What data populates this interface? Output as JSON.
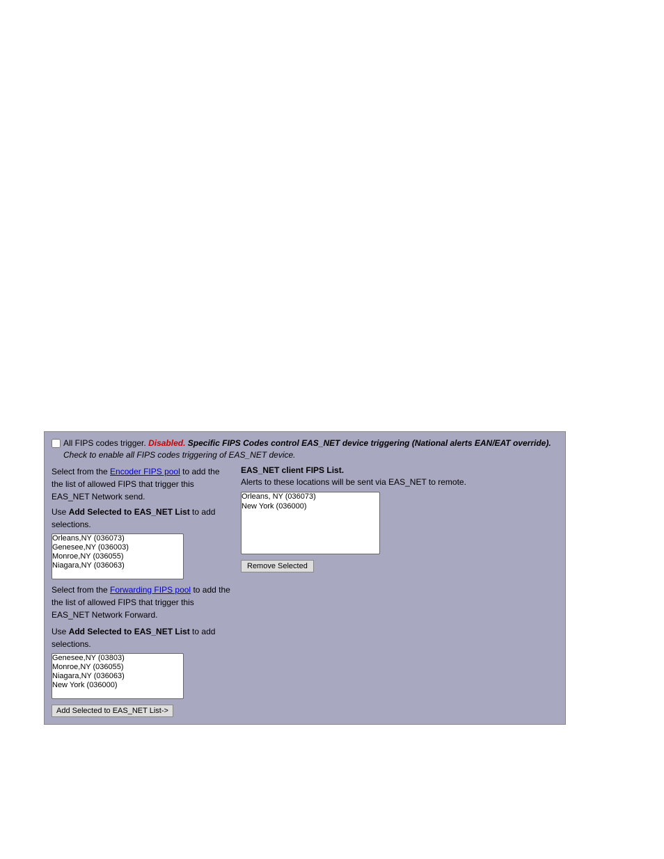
{
  "panel": {
    "top_checkbox_label": "All FIPS codes trigger.",
    "top_status": "Disabled.",
    "top_description": " Specific FIPS Codes control EAS_NET device triggering (National alerts EAN/EAT override).",
    "top_check_note": " Check to enable all FIPS codes triggering of EAS_NET device.",
    "left": {
      "encoder_instruction1": "Select from the ",
      "encoder_link": "Encoder FIPS pool",
      "encoder_instruction2": " to add the the list of allowed FIPS that trigger this EAS_NET Network send.",
      "add_encoder_label": "Use ",
      "add_encoder_bold": "Add Selected to EAS_NET List",
      "add_encoder_suffix": " to add selections.",
      "encoder_options": [
        "Orleans,NY (036073)",
        "Genesee,NY (036003)",
        "Monroe,NY (036055)",
        "Niagara,NY (036063)"
      ],
      "forward_instruction1": "Select from the ",
      "forward_link": "Forwarding FIPS pool",
      "forward_instruction2": " to add the the list of allowed FIPS that trigger this EAS_NET Network Forward.",
      "add_forward_label": "Use ",
      "add_forward_bold": "Add Selected to EAS_NET List",
      "add_forward_suffix": " to add selections.",
      "forward_options": [
        "Genesee,NY (03803)",
        "Monroe,NY (036055)",
        "Niagara,NY (036063)",
        "New York (036000)"
      ],
      "add_button_label": "Add Selected to EAS_NET List->"
    },
    "right": {
      "header": "EAS_NET client FIPS List.",
      "subtext": "Alerts to these locations will be sent via EAS_NET to remote.",
      "eas_net_options": [
        "Orleans, NY (036073)",
        "New York (036000)"
      ],
      "remove_button_label": "Remove Selected"
    }
  }
}
